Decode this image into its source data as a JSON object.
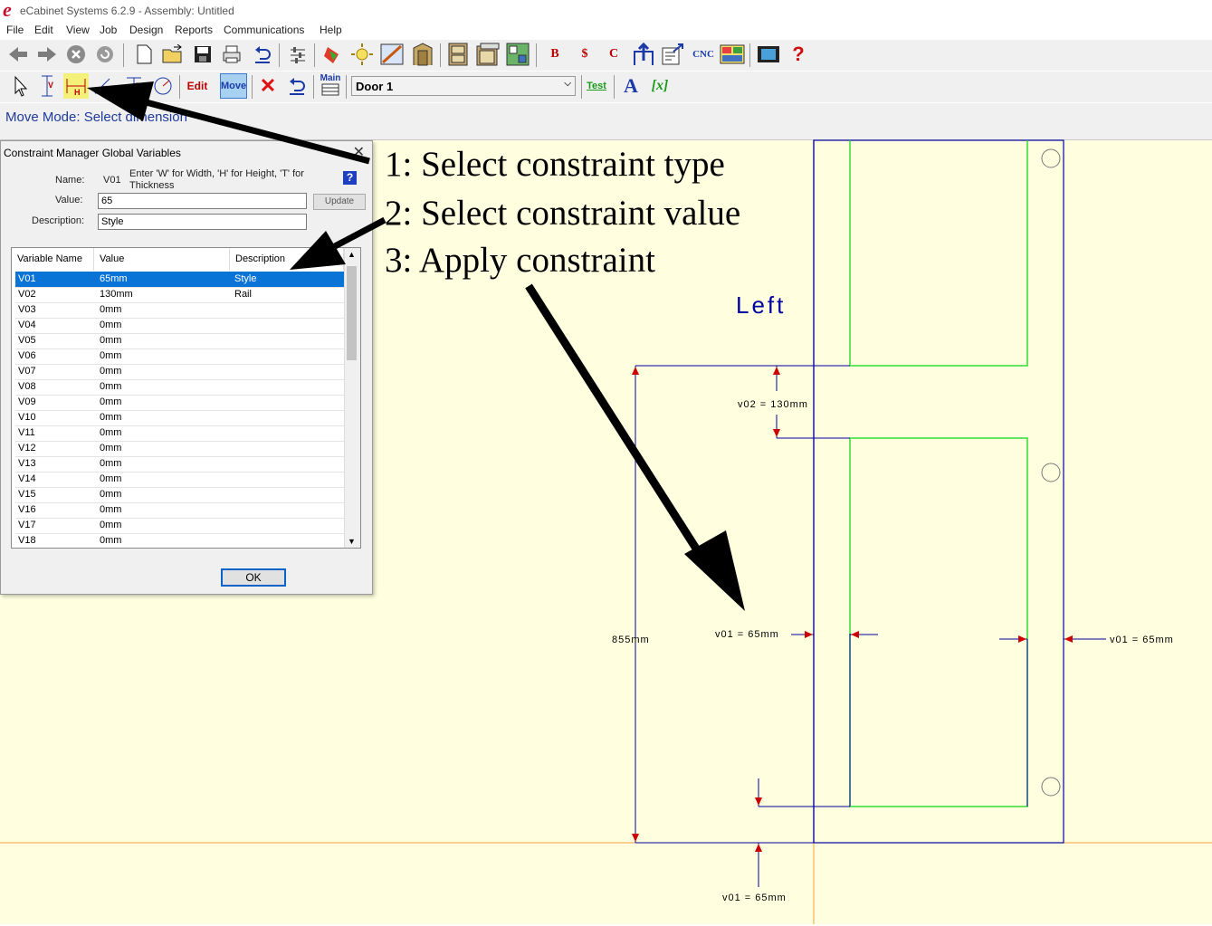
{
  "window": {
    "title": "eCabinet Systems 6.2.9 - Assembly: Untitled",
    "logo": "e"
  },
  "menu": [
    "File",
    "Edit",
    "View",
    "Job",
    "Design",
    "Reports",
    "Communications",
    "Help"
  ],
  "toolbar1": {
    "cnc_label": "CNC",
    "icons": [
      "back-arrow-icon",
      "forward-arrow-icon",
      "stop-icon",
      "refresh-icon",
      "new-file-icon",
      "open-folder-icon",
      "save-icon",
      "print-icon",
      "undo-icon",
      "settings-sliders-icon",
      "paint-icon",
      "light-icon",
      "design-icon",
      "door-frame-icon",
      "cabinet-icon",
      "cabinet-list-icon",
      "layout-icon",
      "report-b-icon",
      "report-cost-icon",
      "report-c-icon",
      "export-icon",
      "send-icon",
      "cnc-icon",
      "nest-icon",
      "film-icon",
      "help-icon"
    ],
    "report_letters": {
      "b": "B",
      "dollar": "$",
      "c": "C"
    },
    "help_glyph": "?"
  },
  "toolbar2": {
    "edit_label": "Edit",
    "move_label": "Move",
    "main_label": "Main",
    "test_label": "Test",
    "text_label": "A",
    "variable_label": "[x]",
    "delete_glyph": "✕",
    "door_select": "Door 1"
  },
  "status": {
    "text": "Move Mode: Select dimension"
  },
  "dialog": {
    "title": "Constraint Manager Global Variables",
    "name_label": "Name:",
    "name_value": "V01",
    "hint": "Enter 'W' for Width, 'H' for Height, 'T' for Thickness",
    "value_label": "Value:",
    "value": "65",
    "description_label": "Description:",
    "description": "Style",
    "update_label": "Update",
    "columns": [
      "Variable Name",
      "Value",
      "Description"
    ],
    "rows": [
      {
        "name": "V01",
        "value": "65mm",
        "desc": "Style"
      },
      {
        "name": "V02",
        "value": "130mm",
        "desc": "Rail"
      },
      {
        "name": "V03",
        "value": "0mm",
        "desc": ""
      },
      {
        "name": "V04",
        "value": "0mm",
        "desc": ""
      },
      {
        "name": "V05",
        "value": "0mm",
        "desc": ""
      },
      {
        "name": "V06",
        "value": "0mm",
        "desc": ""
      },
      {
        "name": "V07",
        "value": "0mm",
        "desc": ""
      },
      {
        "name": "V08",
        "value": "0mm",
        "desc": ""
      },
      {
        "name": "V09",
        "value": "0mm",
        "desc": ""
      },
      {
        "name": "V10",
        "value": "0mm",
        "desc": ""
      },
      {
        "name": "V11",
        "value": "0mm",
        "desc": ""
      },
      {
        "name": "V12",
        "value": "0mm",
        "desc": ""
      },
      {
        "name": "V13",
        "value": "0mm",
        "desc": ""
      },
      {
        "name": "V14",
        "value": "0mm",
        "desc": ""
      },
      {
        "name": "V15",
        "value": "0mm",
        "desc": ""
      },
      {
        "name": "V16",
        "value": "0mm",
        "desc": ""
      },
      {
        "name": "V17",
        "value": "0mm",
        "desc": ""
      },
      {
        "name": "V18",
        "value": "0mm",
        "desc": ""
      }
    ],
    "selected_row": "V01",
    "ok_label": "OK"
  },
  "annotations": {
    "step1": "1: Select constraint type",
    "step2": "2: Select constraint value",
    "step3": "3: Apply constraint"
  },
  "drawing": {
    "side_label": "Left",
    "dim_rail": "v02 = 130mm",
    "dim_height": "855mm",
    "dim_style_left": "v01 = 65mm",
    "dim_style_right": "v01 = 65mm",
    "dim_bottom": "v01 = 65mm"
  },
  "colors": {
    "canvas": "#ffffe0",
    "line_blue": "#0000a0",
    "panel_green": "#33dd33",
    "dim_arrow_red": "#cc0000",
    "selection_blue": "#0a73d6",
    "status_blue": "#1f3a9e",
    "guide_orange": "#f0a040"
  }
}
